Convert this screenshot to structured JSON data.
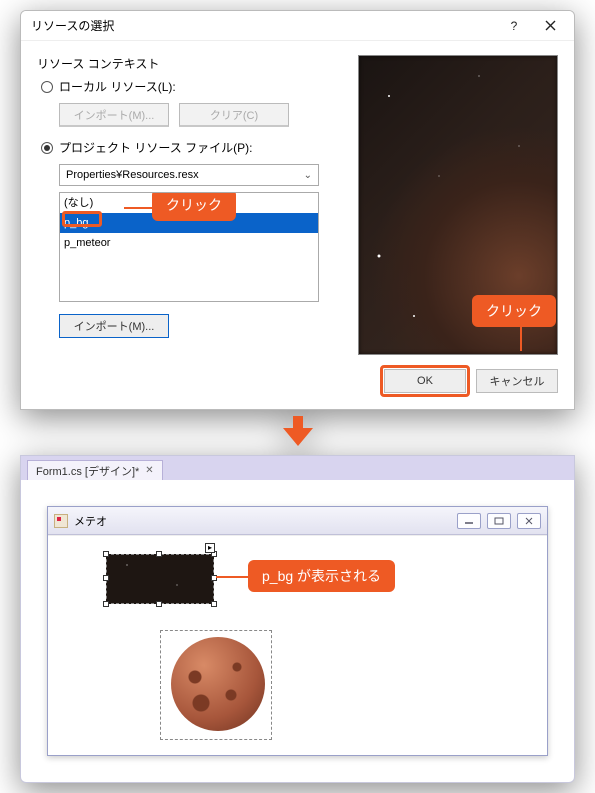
{
  "dialog": {
    "title": "リソースの選択",
    "context_label": "リソース コンテキスト",
    "radio_local": "ローカル リソース(L):",
    "import1": "インポート(M)...",
    "clear": "クリア(C)",
    "radio_project": "プロジェクト リソース ファイル(P):",
    "combo_value": "Properties¥Resources.resx",
    "list": {
      "item0": "(なし)",
      "item1": "p_bg",
      "item2": "p_meteor"
    },
    "import2": "インポート(M)...",
    "ok": "OK",
    "cancel": "キャンセル"
  },
  "callouts": {
    "click1": "クリック",
    "click2": "クリック",
    "result": "p_bg が表示される"
  },
  "designer": {
    "tab": "Form1.cs [デザイン]*",
    "form_title": "メテオ"
  }
}
